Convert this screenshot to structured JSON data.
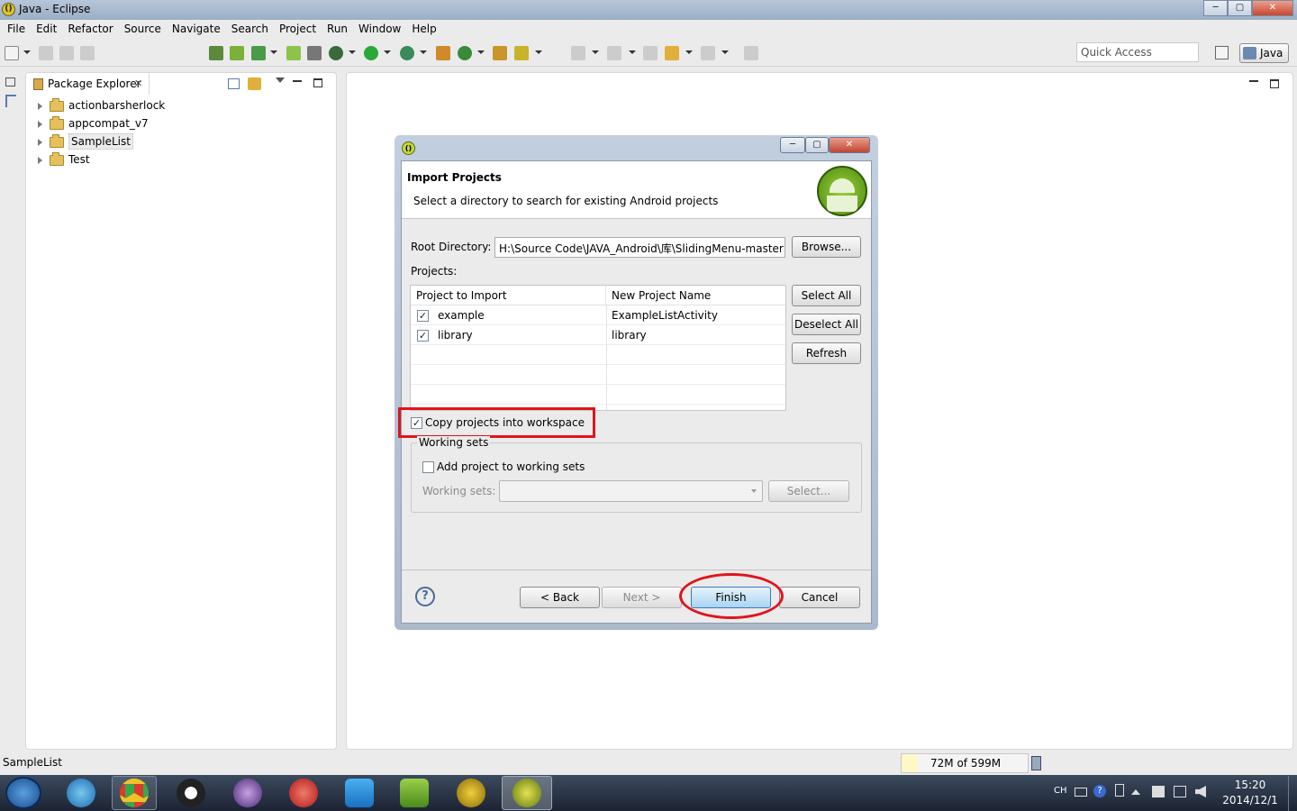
{
  "window": {
    "title": "Java - Eclipse",
    "min": "─",
    "max": "▢",
    "close": "✕"
  },
  "menubar": [
    "File",
    "Edit",
    "Refactor",
    "Source",
    "Navigate",
    "Search",
    "Project",
    "Run",
    "Window",
    "Help"
  ],
  "toolbar": {
    "quick_access_placeholder": "Quick Access",
    "perspective": "Java"
  },
  "package_explorer": {
    "tab_label": "Package Explorer",
    "close": "✕",
    "projects": [
      "actionbarsherlock",
      "appcompat_v7",
      "SampleList",
      "Test"
    ],
    "selected": "SampleList"
  },
  "status": {
    "selection": "SampleList",
    "heap": "72M of 599M"
  },
  "taskbar": {
    "lang": "CH",
    "time": "15:20",
    "date": "2014/12/1"
  },
  "dialog": {
    "heading": "Import Projects",
    "description": "Select a directory to search for existing Android projects",
    "root_directory_label": "Root Directory:",
    "root_directory_value": "H:\\Source Code\\JAVA_Android\\库\\SlidingMenu-master",
    "browse": "Browse...",
    "projects_label": "Projects:",
    "table": {
      "columns": [
        "Project to Import",
        "New Project Name"
      ],
      "rows": [
        {
          "project": "example",
          "new_name": "ExampleListActivity",
          "checked": true
        },
        {
          "project": "library",
          "new_name": "library",
          "checked": true
        }
      ]
    },
    "select_all": "Select All",
    "deselect_all": "Deselect All",
    "refresh": "Refresh",
    "copy_label": "Copy projects into workspace",
    "copy_checked": true,
    "working_sets_group": "Working sets",
    "add_to_ws_label": "Add project to working sets",
    "working_sets_label": "Working sets:",
    "select_btn": "Select...",
    "back": "< Back",
    "next": "Next >",
    "finish": "Finish",
    "cancel": "Cancel",
    "help": "?",
    "highlight_color": "#e0141c"
  }
}
